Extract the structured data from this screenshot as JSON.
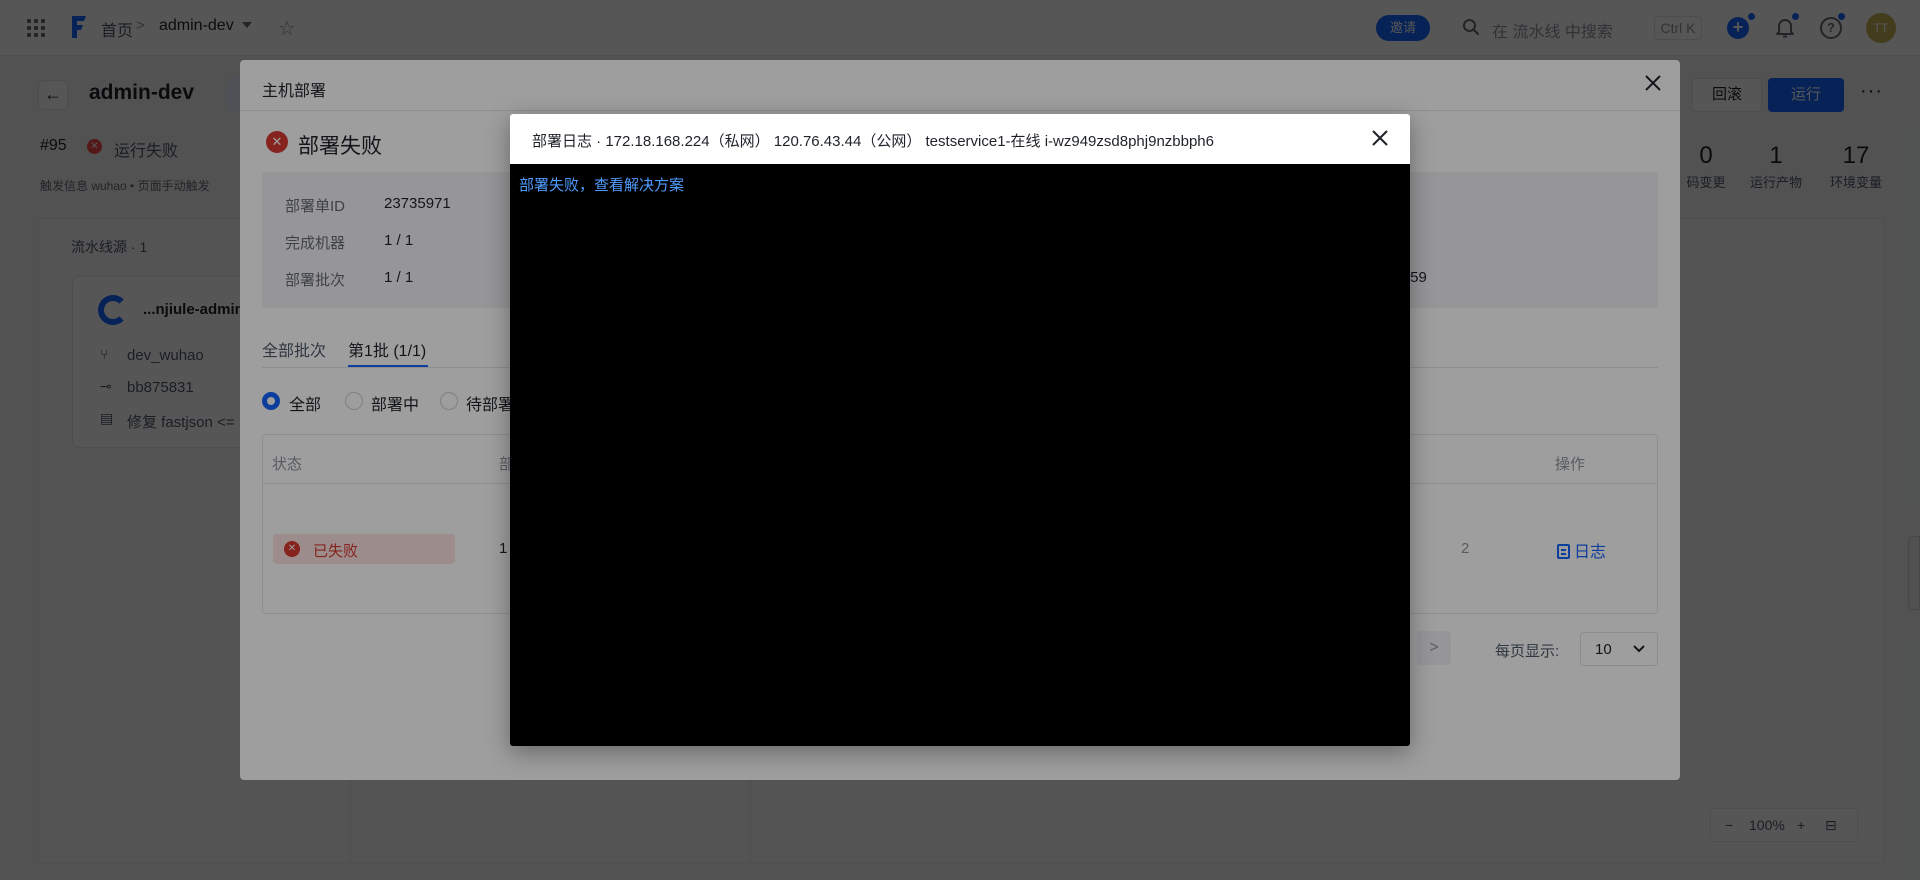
{
  "topbar": {
    "breadcrumb_home": "首页",
    "breadcrumb_sep": ">",
    "project": "admin-dev",
    "invite_label": "邀请",
    "search_placeholder": "在 流水线 中搜索",
    "shortcut": "Ctrl K",
    "avatar_initials": "TT",
    "plus_label": "+",
    "help_label": "?",
    "star_glyph": "☆"
  },
  "header": {
    "title": "admin-dev",
    "rollback_label": "回滚",
    "run_label": "运行",
    "run_id": "#95",
    "run_status": "运行失败",
    "trigger_info": "触发信息  wuhao  • 页面手动触发",
    "stats": [
      {
        "num": "0",
        "label": "码变更"
      },
      {
        "num": "1",
        "label": "运行产物"
      },
      {
        "num": "17",
        "label": "环境变量"
      }
    ]
  },
  "source": {
    "label": "流水线源 · 1",
    "repo": "...njiule-admin",
    "branch": "dev_wuhao",
    "commit": "bb875831",
    "message": "修复 fastjson <="
  },
  "zoom": {
    "minus": "−",
    "level": "100%",
    "plus": "+"
  },
  "modal": {
    "title": "主机部署",
    "fail_title": "部署失败",
    "info": [
      {
        "label": "部署单ID",
        "value": "23735971"
      },
      {
        "label": "完成机器",
        "value": "1 / 1"
      },
      {
        "label": "部署批次",
        "value": "1 / 1"
      }
    ],
    "info_tail": ":59",
    "tabs": [
      "全部批次",
      "第1批 (1/1)"
    ],
    "filters": [
      "全部",
      "部署中",
      "待部署"
    ],
    "table": {
      "headers": [
        "状态",
        "部",
        "操作"
      ],
      "row": {
        "status": "已失败",
        "col1": "1",
        "col2": "2",
        "action": "日志"
      }
    },
    "page_size_label": "每页显示:",
    "page_size": "10",
    "next_glyph": ">"
  },
  "log_modal": {
    "title": "部署日志 · 172.18.168.224（私网） 120.76.43.44（公网） testservice1-在线 i-wz949zsd8phj9nzbbph6",
    "link_text": "部署失败，查看解决方案"
  },
  "colors": {
    "accent": "#1664ff",
    "danger": "#d83931",
    "terminal_bg": "#000000",
    "terminal_link": "#4f9cff"
  }
}
